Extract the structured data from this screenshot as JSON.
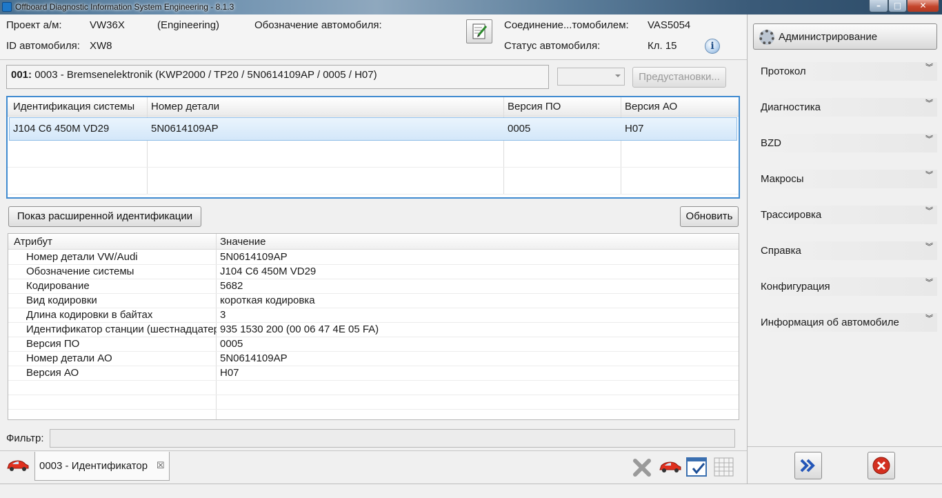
{
  "window": {
    "title": "Offboard Diagnostic Information System Engineering - 8.1.3"
  },
  "header": {
    "project_label": "Проект а/м:",
    "project_value": "VW36X",
    "project_mode": "(Engineering)",
    "vehicle_designation_label": "Обозначение автомобиля:",
    "vehicle_id_label": "ID автомобиля:",
    "vehicle_id_value": "XW8",
    "connection_label": "Соединение...томобилем:",
    "connection_value": "VAS5054",
    "status_label": "Статус автомобиля:",
    "status_value": "Кл. 15"
  },
  "ecu": {
    "address": "001:",
    "description": "0003 - Bremsenelektronik  (KWP2000 / TP20 / 5N0614109AP / 0005 / H07)",
    "presets_button": "Предустановки..."
  },
  "id_table": {
    "columns": [
      "Идентификация системы",
      "Номер детали",
      "Версия ПО",
      "Версия АО"
    ],
    "rows": [
      [
        "J104   C6 450M VD29",
        "5N0614109AP",
        "0005",
        "H07"
      ]
    ]
  },
  "buttons": {
    "extended_id": "Показ расширенной идентификации",
    "refresh": "Обновить"
  },
  "attr_table": {
    "columns": [
      "Атрибут",
      "Значение"
    ],
    "rows": [
      [
        "Номер детали VW/Audi",
        "5N0614109AP"
      ],
      [
        "Обозначение системы",
        "J104   C6 450M VD29"
      ],
      [
        "Кодирование",
        "5682"
      ],
      [
        "Вид кодировки",
        "короткая кодировка"
      ],
      [
        "Длина кодировки в байтах",
        "3"
      ],
      [
        "Идентификатор станции (шестнадцатеричный)",
        "935 1530 200 (00 06 47 4E 05 FA)"
      ],
      [
        "Версия ПО",
        "0005"
      ],
      [
        "Номер детали АО",
        "5N0614109AP"
      ],
      [
        "Версия АО",
        "H07"
      ]
    ]
  },
  "filter": {
    "label": "Фильтр:",
    "value": ""
  },
  "tabs": {
    "active_tab": "0003 - Идентификатор",
    "close_glyph": "☒"
  },
  "right_panel": {
    "admin_button": "Администрирование",
    "chevron": "»",
    "items": [
      "Протокол",
      "Диагностика",
      "BZD",
      "Макросы",
      "Трассировка",
      "Справка",
      "Конфигурация",
      "Информация об автомобиле"
    ]
  },
  "colors": {
    "selection_border": "#3f8ad0",
    "selected_row": "#d3e7f9",
    "close_red": "#d32f1f",
    "forward_blue": "#2456b8"
  }
}
